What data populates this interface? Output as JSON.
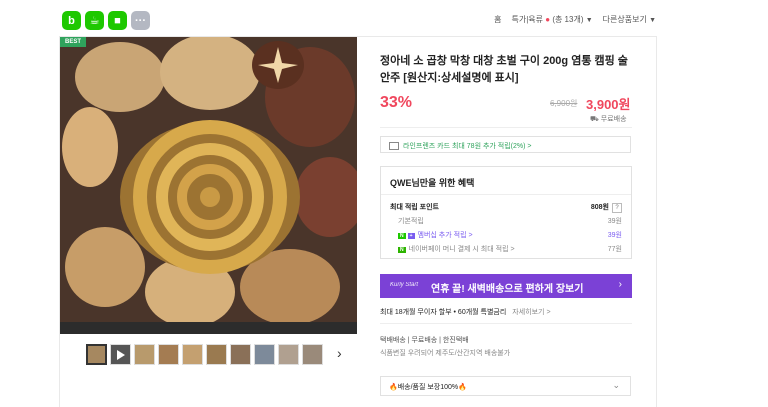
{
  "header": {
    "home_label": "홈",
    "breadcrumb_1": "특가|육류",
    "breadcrumb_2": "(총 13개)",
    "other_products": "다른상품보기",
    "app_icon_colors": [
      "#1ec800",
      "#1ec800",
      "#1ec800",
      "#b4b8c2"
    ],
    "app_icon_names": [
      "blog-icon",
      "cafe-icon",
      "bookmark-icon",
      "more-icon"
    ]
  },
  "product": {
    "best_badge": "BEST",
    "title": "정아네 소 곱창 막창 대창 초벌 구이 200g 염통 캠핑 술안주 [원산지:상세설명에 표시]",
    "discount": "33%",
    "original_price": "6,900원",
    "price": "3,900원",
    "free_shipping": "무료배송",
    "card_promo": "라인프렌즈 카드 최대 78원 추가 적립(2%) >"
  },
  "benefits": {
    "title": "QWE님만을 위한 혜택",
    "max_label": "최대 적립 포인트",
    "max_value": "808원",
    "basic_label": "기본적립",
    "basic_value": "39원",
    "membership_label": "멤버십 추가 적립 >",
    "membership_value": "39원",
    "pay_label": "네이버페이 머니 결제 시 최대 적립 >",
    "pay_value": "77원"
  },
  "banner": {
    "brand": "Kurly Start",
    "text": "연휴 끝! 새벽배송으로 편하게 장보기",
    "arrow": "›"
  },
  "installment": {
    "text": "최대 18개월 무이자 할부 • 60개월 특별금리",
    "more": "자세히보기 >"
  },
  "shipping": {
    "line1": "택배배송 | 무료배송 | 한진택배",
    "line2": "식품변질 우려되어 제주도/산간지역 배송불가"
  },
  "guarantee": {
    "text": "배송/품질 보장100%"
  }
}
